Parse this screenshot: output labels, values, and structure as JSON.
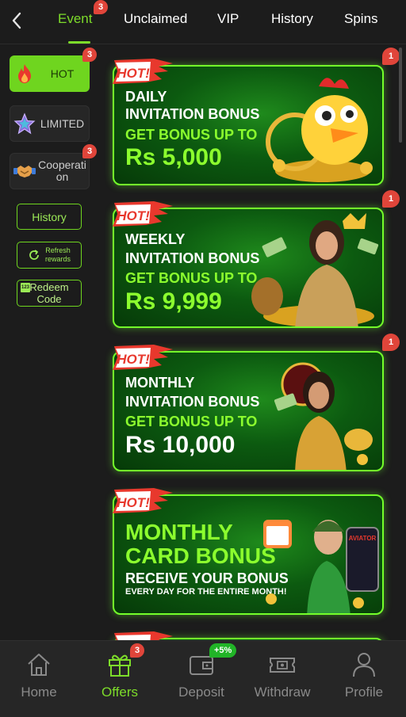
{
  "header": {
    "tabs": [
      {
        "label": "Event",
        "active": true,
        "badge": "3"
      },
      {
        "label": "Unclaimed"
      },
      {
        "label": "VIP"
      },
      {
        "label": "History"
      },
      {
        "label": "Spins"
      }
    ]
  },
  "sidebar": {
    "categories": [
      {
        "label": "HOT",
        "icon": "fire-icon",
        "active": true,
        "badge": "3"
      },
      {
        "label": "LIMITED",
        "icon": "star-icon"
      },
      {
        "label": "Cooperation",
        "line1": "Cooperati",
        "line2": "on",
        "icon": "handshake-icon",
        "badge": "3"
      }
    ],
    "history_label": "History",
    "refresh_label_1": "Refresh",
    "refresh_label_2": "rewards",
    "redeem_label_1": "Redeem",
    "redeem_label_2": "Code",
    "redeem_icon_text": "123"
  },
  "hot_label": "HOT!",
  "banners": [
    {
      "badge": "1",
      "line1": "DAILY",
      "line2": "INVITATION BONUS",
      "line3": "GET BONUS UP TO",
      "amount": "Rs 5,000"
    },
    {
      "badge": "1",
      "line1": "WEEKLY",
      "line2": "INVITATION BONUS",
      "line3": "GET BONUS UP TO",
      "amount": "Rs 9,999"
    },
    {
      "badge": "1",
      "line1": "MONTHLY",
      "line2": "INVITATION BONUS",
      "line3": "GET BONUS UP TO",
      "amount": "Rs 10,000"
    },
    {
      "line1": "MONTHLY",
      "line2": "CARD BONUS",
      "line3": "RECEIVE YOUR BONUS",
      "line4": "EVERY DAY FOR THE ENTIRE MONTH!",
      "aviator": "AVIATOR"
    }
  ],
  "bottom_nav": [
    {
      "label": "Home",
      "icon": "home-icon"
    },
    {
      "label": "Offers",
      "icon": "gift-icon",
      "active": true,
      "badge": "3"
    },
    {
      "label": "Deposit",
      "icon": "wallet-icon",
      "badge": "+5%"
    },
    {
      "label": "Withdraw",
      "icon": "ticket-icon"
    },
    {
      "label": "Profile",
      "icon": "user-icon"
    }
  ],
  "colors": {
    "accent": "#7ddc2a",
    "badge": "#e0453a",
    "background": "#1c1c1c",
    "banner_border": "#74ff2a",
    "banner_text_green": "#8cff2e"
  }
}
